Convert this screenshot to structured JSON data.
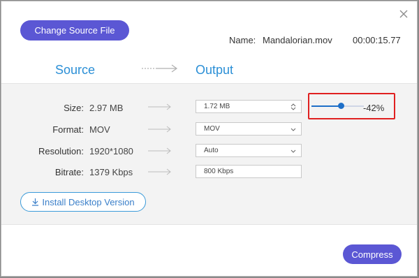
{
  "header": {
    "change_source_label": "Change Source File",
    "name_label": "Name:",
    "file_name": "Mandalorian.mov",
    "duration": "00:00:15.77"
  },
  "columns": {
    "source": "Source",
    "output": "Output"
  },
  "rows": [
    {
      "label": "Size:",
      "source_value": "2.97 MB",
      "output_value": "1.72  MB",
      "control": "stepper"
    },
    {
      "label": "Format:",
      "source_value": "MOV",
      "output_value": "MOV",
      "control": "dropdown"
    },
    {
      "label": "Resolution:",
      "source_value": "1920*1080",
      "output_value": "Auto",
      "control": "dropdown"
    },
    {
      "label": "Bitrate:",
      "source_value": "1379 Kbps",
      "output_value": "800 Kbps",
      "control": "readonly"
    }
  ],
  "size_slider": {
    "percent_label": "-42%",
    "fill_fraction": 0.57
  },
  "install_label": "Install Desktop Version",
  "compress_label": "Compress",
  "colors": {
    "accent": "#5b57d4",
    "heading": "#2b8fd6",
    "highlight": "#e02020"
  },
  "icons": [
    "close-icon",
    "arrow-right-icon",
    "stepper-icon",
    "chevron-down-icon",
    "download-icon"
  ]
}
